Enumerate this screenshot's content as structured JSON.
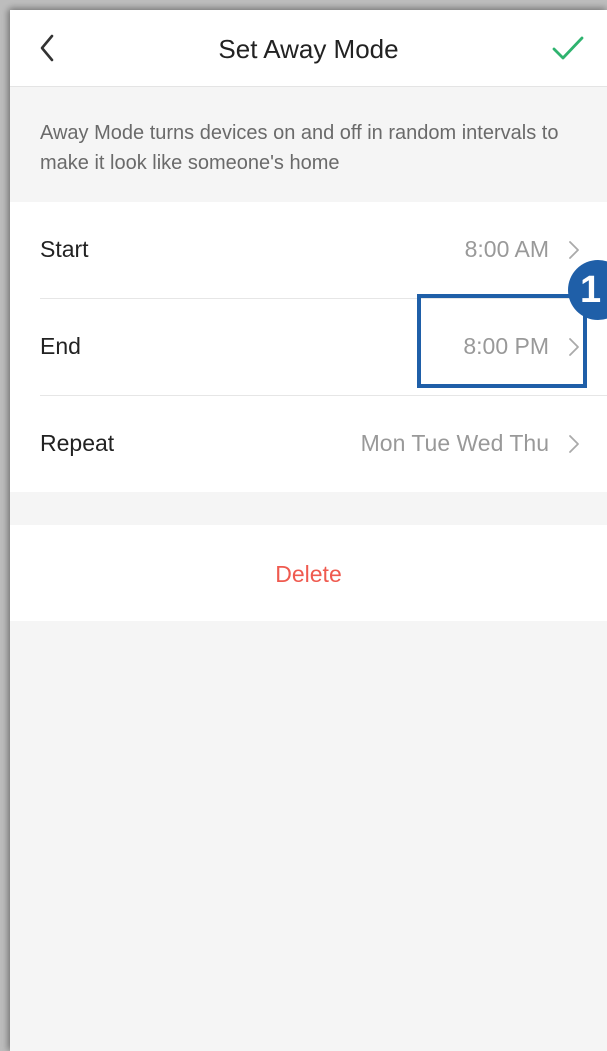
{
  "header": {
    "title": "Set Away Mode",
    "back_icon": "chevron-left-icon",
    "confirm_icon": "checkmark-icon",
    "confirm_color": "#2fb36f"
  },
  "description": "Away Mode turns devices on and off in random intervals to make it look like someone's home",
  "settings": [
    {
      "label": "Start",
      "value": "8:00 AM"
    },
    {
      "label": "End",
      "value": "8:00 PM"
    },
    {
      "label": "Repeat",
      "value": "Mon Tue Wed Thu"
    }
  ],
  "delete_label": "Delete",
  "delete_color": "#ef5a4f",
  "annotation": {
    "badge_number": "1",
    "highlight_color": "#1f5fa8"
  }
}
